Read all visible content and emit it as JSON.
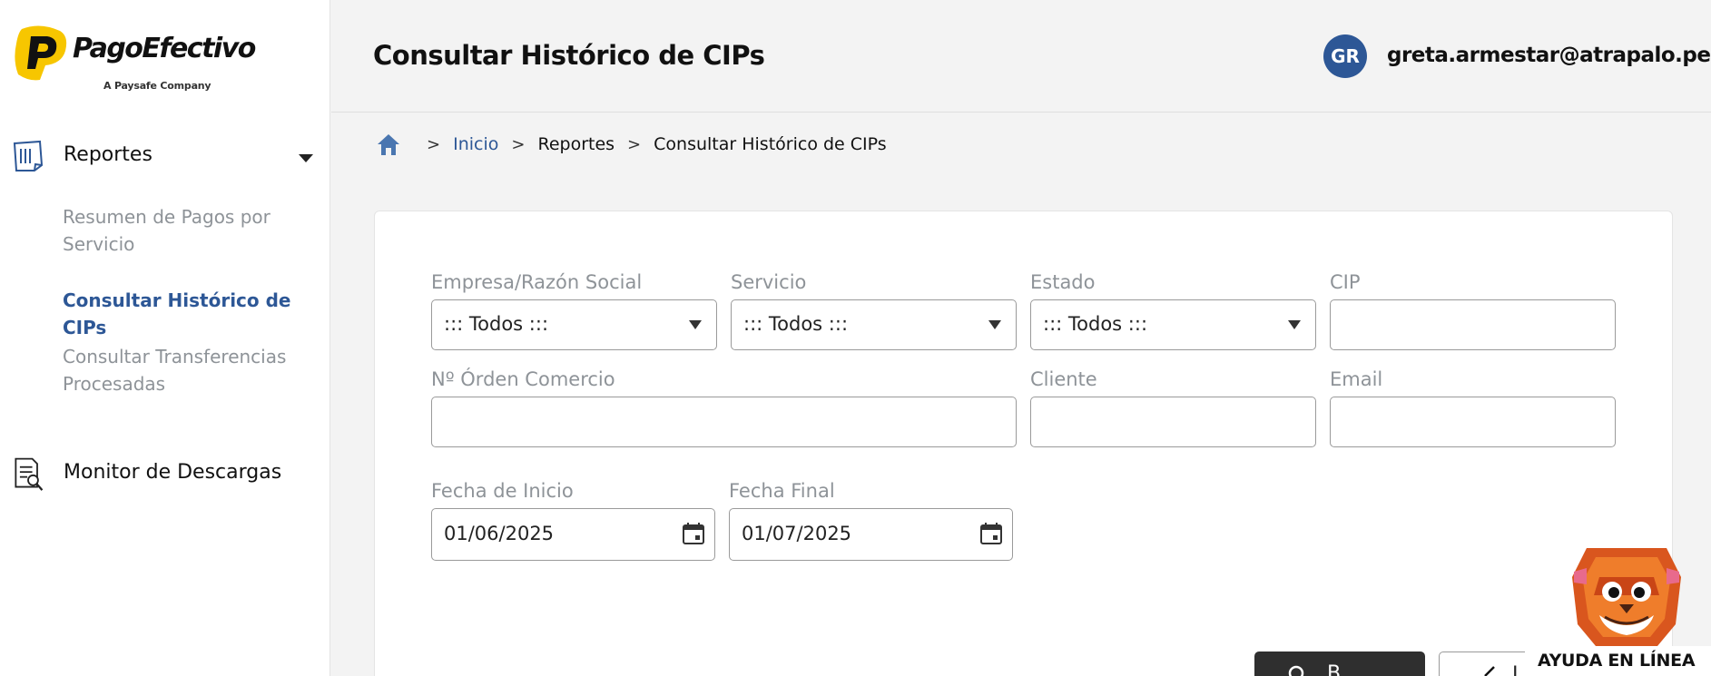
{
  "brand": {
    "name": "PagoEfectivo",
    "tagline": "A Paysafe Company",
    "color": "#f7c600"
  },
  "colors": {
    "accent": "#2d5796",
    "muted": "#8e9398",
    "dark_button": "#2f2f2f"
  },
  "sidebar": {
    "sections": [
      {
        "label": "Reportes",
        "icon": "report-icon",
        "expanded": true,
        "items": [
          {
            "label": "Resumen de Pagos por Servicio",
            "active": false
          },
          {
            "label": "Consultar Histórico de CIPs",
            "active": true
          },
          {
            "label": "Consultar Transferencias Procesadas",
            "active": false
          }
        ]
      },
      {
        "label": "Monitor de Descargas",
        "icon": "download-monitor-icon"
      }
    ]
  },
  "header": {
    "title": "Consultar Histórico de CIPs",
    "user": {
      "initials": "GR",
      "email": "greta.armestar@atrapalo.pe"
    }
  },
  "breadcrumb": {
    "home_icon": "home-icon",
    "items": [
      "Inicio",
      "Reportes",
      "Consultar Histórico de CIPs"
    ]
  },
  "form": {
    "empresa": {
      "label": "Empresa/Razón Social",
      "value": "::: Todos :::"
    },
    "servicio": {
      "label": "Servicio",
      "value": "::: Todos :::"
    },
    "estado": {
      "label": "Estado",
      "value": "::: Todos :::"
    },
    "cip": {
      "label": "CIP",
      "value": ""
    },
    "orden": {
      "label": "Nº Órden Comercio",
      "value": ""
    },
    "cliente": {
      "label": "Cliente",
      "value": ""
    },
    "email": {
      "label": "Email",
      "value": ""
    },
    "fecha_inicio": {
      "label": "Fecha de Inicio",
      "value": "01/06/2025"
    },
    "fecha_final": {
      "label": "Fecha Final",
      "value": "01/07/2025"
    }
  },
  "buttons": {
    "search_label": "B",
    "clear_label": "Li"
  },
  "help": {
    "label": "AYUDA EN LÍNEA"
  }
}
